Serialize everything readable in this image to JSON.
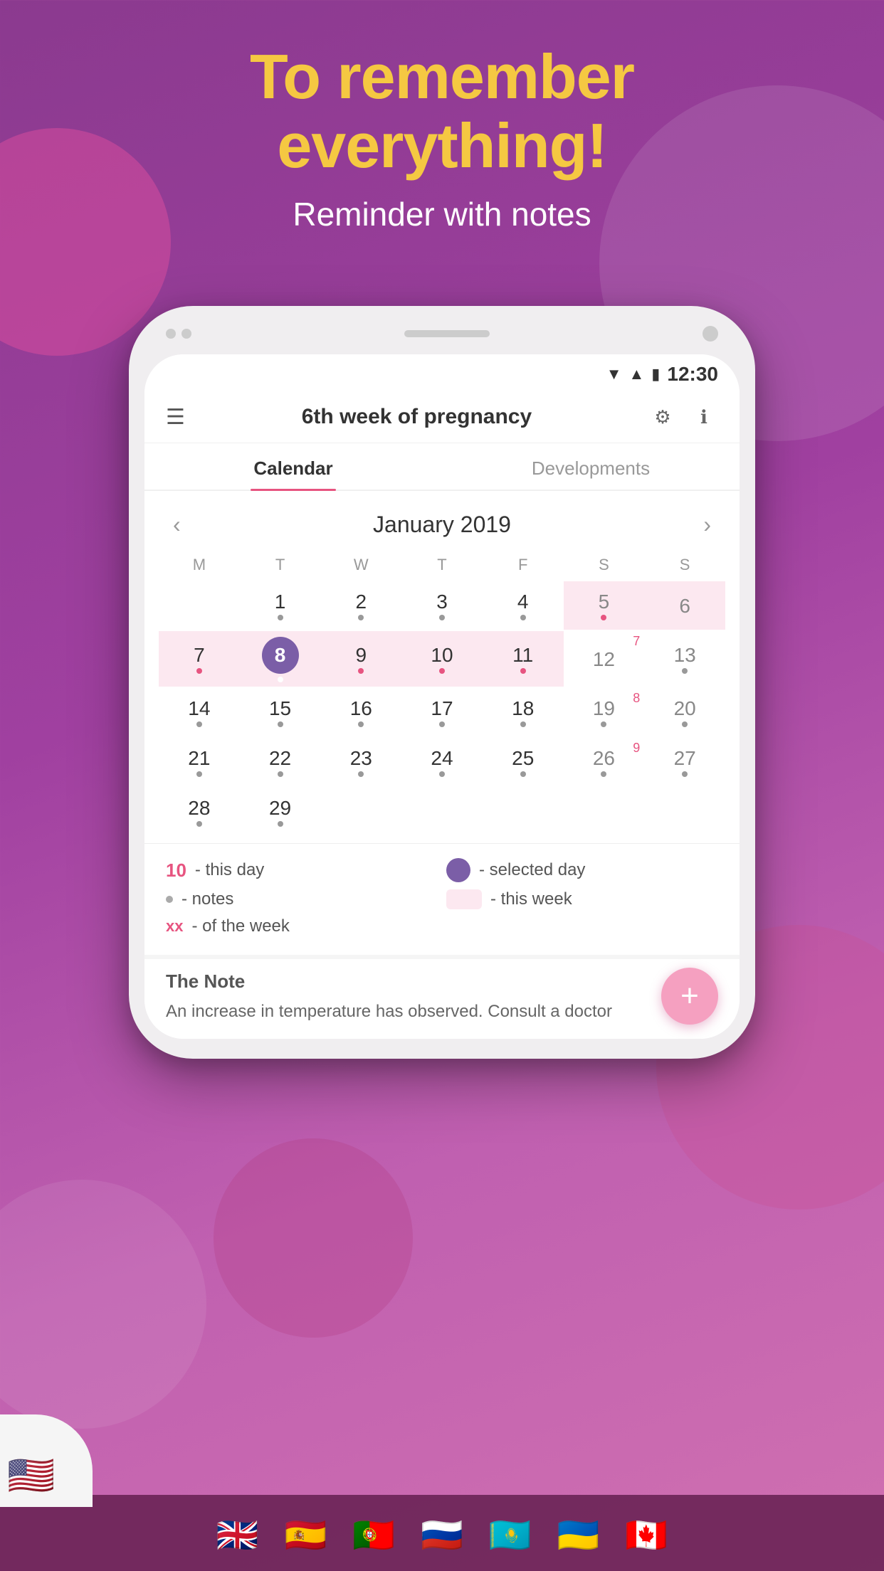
{
  "hero": {
    "title_line1": "To remember",
    "title_line2": "everything!",
    "subtitle": "Reminder with notes"
  },
  "status_bar": {
    "time": "12:30"
  },
  "app_header": {
    "title": "6th week of pregnancy"
  },
  "tabs": [
    {
      "label": "Calendar",
      "active": true
    },
    {
      "label": "Developments",
      "active": false
    }
  ],
  "calendar": {
    "month_year": "January 2019",
    "day_headers": [
      "M",
      "T",
      "W",
      "T",
      "F",
      "S",
      "S"
    ],
    "rows": [
      [
        {
          "day": "",
          "empty": true
        },
        {
          "day": "1",
          "dot": true
        },
        {
          "day": "2",
          "dot": true
        },
        {
          "day": "3",
          "dot": true
        },
        {
          "day": "4",
          "dot": true
        },
        {
          "day": "5",
          "dot": true,
          "weekend": true,
          "this_week": true
        },
        {
          "day": "6",
          "dot": false,
          "weekend": true,
          "this_week": true
        }
      ],
      [
        {
          "day": "7",
          "dot": true,
          "this_week": true
        },
        {
          "day": "8",
          "dot": true,
          "today": true,
          "this_week": true
        },
        {
          "day": "9",
          "dot": true,
          "this_week": true
        },
        {
          "day": "10",
          "dot": true,
          "this_week": true
        },
        {
          "day": "11",
          "dot": true,
          "this_week": true
        },
        {
          "day": "12",
          "dot": false,
          "weekend": true,
          "week_num": "7"
        },
        {
          "day": "13",
          "dot": true,
          "weekend": true
        }
      ],
      [
        {
          "day": "14",
          "dot": true
        },
        {
          "day": "15",
          "dot": true
        },
        {
          "day": "16",
          "dot": true
        },
        {
          "day": "17",
          "dot": true
        },
        {
          "day": "18",
          "dot": true
        },
        {
          "day": "19",
          "dot": true,
          "weekend": true,
          "week_num": "8"
        },
        {
          "day": "20",
          "dot": true,
          "weekend": true
        }
      ],
      [
        {
          "day": "21",
          "dot": true
        },
        {
          "day": "22",
          "dot": true
        },
        {
          "day": "23",
          "dot": true
        },
        {
          "day": "24",
          "dot": true
        },
        {
          "day": "25",
          "dot": true
        },
        {
          "day": "26",
          "dot": true,
          "weekend": true,
          "week_num": "9"
        },
        {
          "day": "27",
          "dot": true,
          "weekend": true
        }
      ],
      [
        {
          "day": "28",
          "dot": true
        },
        {
          "day": "29",
          "dot": true
        },
        {
          "day": "",
          "empty": true
        },
        {
          "day": "",
          "empty": true
        },
        {
          "day": "",
          "empty": true
        },
        {
          "day": "",
          "empty": true
        },
        {
          "day": "",
          "empty": true
        }
      ]
    ]
  },
  "legend": {
    "this_day_label": "- this day",
    "notes_label": "- notes",
    "week_label": "- of the week",
    "selected_day_label": "- selected day",
    "this_week_label": "- this week",
    "this_day_num": "10",
    "week_xx": "xx"
  },
  "notes": {
    "title": "The Note",
    "text": "An increase in temperature has observed.\nConsult a doctor"
  },
  "fab": {
    "label": "+"
  },
  "flags": [
    "🇬🇧",
    "🇪🇸",
    "🇵🇹",
    "🇷🇺",
    "🇰🇿",
    "🇺🇦",
    "🇨🇦"
  ],
  "usa_flag": "🇺🇸"
}
